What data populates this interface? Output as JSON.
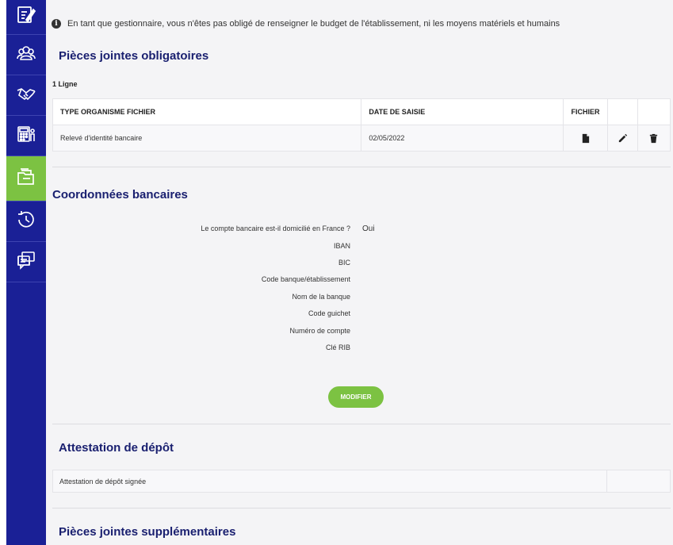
{
  "sidebar": {
    "items": [
      {
        "icon": "edit-form-icon",
        "active": false
      },
      {
        "icon": "users-icon",
        "active": false
      },
      {
        "icon": "handshake-icon",
        "active": false
      },
      {
        "icon": "calculator-icon",
        "active": false
      },
      {
        "icon": "folder-icon",
        "active": true
      },
      {
        "icon": "history-icon",
        "active": false
      },
      {
        "icon": "chat-icon",
        "active": false
      }
    ],
    "background": "#1a2096",
    "active_color": "#7cc242"
  },
  "info": {
    "text": "En tant que gestionnaire, vous n'êtes pas obligé de renseigner le budget de l'établissement, ni les moyens matériels et humains"
  },
  "attachments": {
    "title": "Pièces jointes obligatoires",
    "count_label": "1 Ligne",
    "columns": [
      "TYPE ORGANISME FICHIER",
      "DATE DE SAISIE",
      "FICHIER",
      "",
      ""
    ],
    "rows": [
      {
        "type": "Relevé d'identité bancaire",
        "date": "02/05/2022"
      }
    ]
  },
  "bank": {
    "title": "Coordonnées bancaires",
    "fields": [
      {
        "label": "Le compte bancaire est-il domicilié en France ?",
        "value": "Oui"
      },
      {
        "label": "IBAN",
        "value": ""
      },
      {
        "label": "BIC",
        "value": ""
      },
      {
        "label": "Code banque/établissement",
        "value": ""
      },
      {
        "label": "Nom de la banque",
        "value": ""
      },
      {
        "label": "Code guichet",
        "value": ""
      },
      {
        "label": "Numéro de compte",
        "value": ""
      },
      {
        "label": "Clé RIB",
        "value": ""
      }
    ],
    "button_label": "MODIFIER"
  },
  "deposit": {
    "title": "Attestation de dépôt",
    "row_label": "Attestation de dépôt signée"
  },
  "extra": {
    "title": "Pièces jointes supplémentaires"
  }
}
